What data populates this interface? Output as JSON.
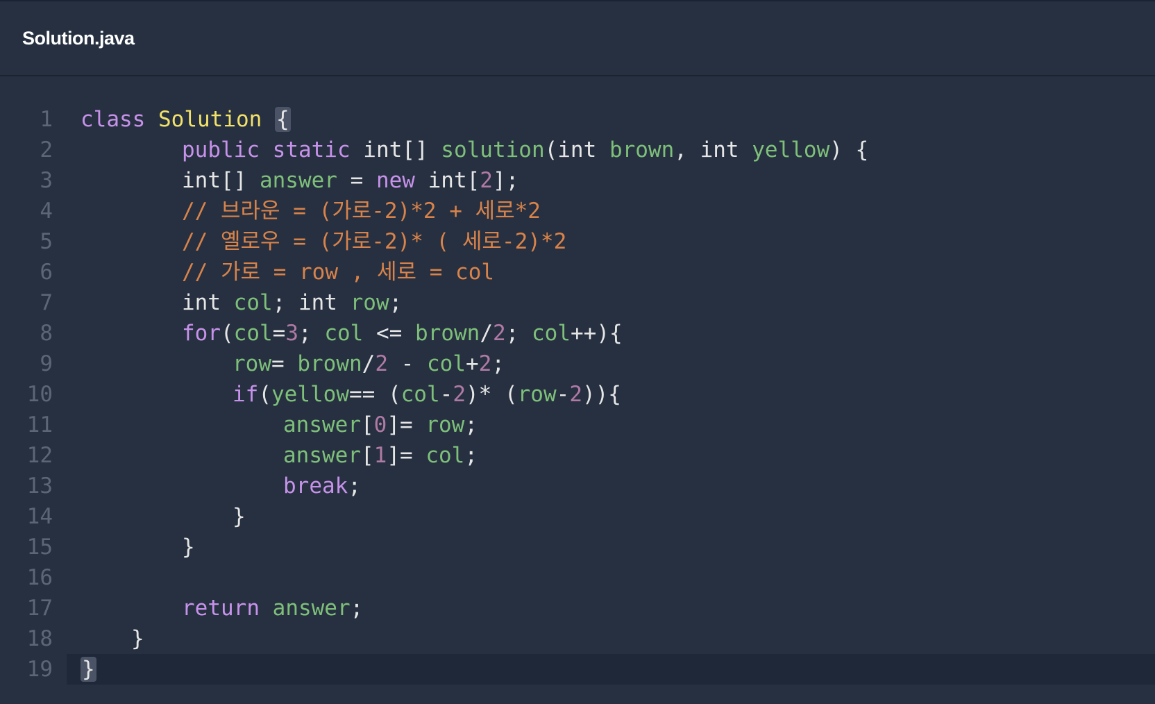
{
  "tab": {
    "file_name": "Solution.java"
  },
  "colors": {
    "background": "#263040",
    "keyword": "#c792ea",
    "class_name": "#f3e26a",
    "identifier": "#7ec07a",
    "number": "#b07aa6",
    "comment": "#d9834a",
    "text": "#e6e6e6",
    "line_number": "#5c6677"
  },
  "editor": {
    "active_line": 19,
    "lines": [
      {
        "number": "1",
        "indent": 0,
        "tokens": [
          [
            "kw",
            "class"
          ],
          [
            "tx",
            " "
          ],
          [
            "cls",
            "Solution"
          ],
          [
            "tx",
            " "
          ],
          [
            "hl",
            "{"
          ]
        ]
      },
      {
        "number": "2",
        "indent": 4,
        "tokens": [
          [
            "kw",
            "public"
          ],
          [
            "tx",
            " "
          ],
          [
            "kw",
            "static"
          ],
          [
            "tx",
            " int[] "
          ],
          [
            "id",
            "solution"
          ],
          [
            "tx",
            "(int "
          ],
          [
            "id",
            "brown"
          ],
          [
            "tx",
            ", int "
          ],
          [
            "id",
            "yellow"
          ],
          [
            "tx",
            ") {"
          ]
        ]
      },
      {
        "number": "3",
        "indent": 4,
        "tokens": [
          [
            "tx",
            "int[] "
          ],
          [
            "id",
            "answer"
          ],
          [
            "tx",
            " = "
          ],
          [
            "kw",
            "new"
          ],
          [
            "tx",
            " int["
          ],
          [
            "num",
            "2"
          ],
          [
            "tx",
            "];"
          ]
        ]
      },
      {
        "number": "4",
        "indent": 4,
        "tokens": [
          [
            "cm",
            "// 브라운 = (가로-2)*2 + 세로*2"
          ]
        ]
      },
      {
        "number": "5",
        "indent": 4,
        "tokens": [
          [
            "cm",
            "// 옐로우 = (가로-2)* ( 세로-2)*2"
          ]
        ]
      },
      {
        "number": "6",
        "indent": 4,
        "tokens": [
          [
            "cm",
            "// 가로 = row , 세로 = col"
          ]
        ]
      },
      {
        "number": "7",
        "indent": 4,
        "tokens": [
          [
            "tx",
            "int "
          ],
          [
            "id",
            "col"
          ],
          [
            "tx",
            "; int "
          ],
          [
            "id",
            "row"
          ],
          [
            "tx",
            ";"
          ]
        ]
      },
      {
        "number": "8",
        "indent": 4,
        "tokens": [
          [
            "kw",
            "for"
          ],
          [
            "tx",
            "("
          ],
          [
            "id",
            "col"
          ],
          [
            "tx",
            "="
          ],
          [
            "num",
            "3"
          ],
          [
            "tx",
            "; "
          ],
          [
            "id",
            "col"
          ],
          [
            "tx",
            " <= "
          ],
          [
            "id",
            "brown"
          ],
          [
            "tx",
            "/"
          ],
          [
            "num",
            "2"
          ],
          [
            "tx",
            "; "
          ],
          [
            "id",
            "col"
          ],
          [
            "tx",
            "++){"
          ]
        ]
      },
      {
        "number": "9",
        "indent": 6,
        "tokens": [
          [
            "id",
            "row"
          ],
          [
            "tx",
            "= "
          ],
          [
            "id",
            "brown"
          ],
          [
            "tx",
            "/"
          ],
          [
            "num",
            "2"
          ],
          [
            "tx",
            " - "
          ],
          [
            "id",
            "col"
          ],
          [
            "tx",
            "+"
          ],
          [
            "num",
            "2"
          ],
          [
            "tx",
            ";"
          ]
        ]
      },
      {
        "number": "10",
        "indent": 6,
        "tokens": [
          [
            "kw",
            "if"
          ],
          [
            "tx",
            "("
          ],
          [
            "id",
            "yellow"
          ],
          [
            "tx",
            "== ("
          ],
          [
            "id",
            "col"
          ],
          [
            "tx",
            "-"
          ],
          [
            "num",
            "2"
          ],
          [
            "tx",
            ")* ("
          ],
          [
            "id",
            "row"
          ],
          [
            "tx",
            "-"
          ],
          [
            "num",
            "2"
          ],
          [
            "tx",
            ")){"
          ]
        ]
      },
      {
        "number": "11",
        "indent": 8,
        "tokens": [
          [
            "id",
            "answer"
          ],
          [
            "tx",
            "["
          ],
          [
            "num",
            "0"
          ],
          [
            "tx",
            "]= "
          ],
          [
            "id",
            "row"
          ],
          [
            "tx",
            ";"
          ]
        ]
      },
      {
        "number": "12",
        "indent": 8,
        "tokens": [
          [
            "id",
            "answer"
          ],
          [
            "tx",
            "["
          ],
          [
            "num",
            "1"
          ],
          [
            "tx",
            "]= "
          ],
          [
            "id",
            "col"
          ],
          [
            "tx",
            ";"
          ]
        ]
      },
      {
        "number": "13",
        "indent": 8,
        "tokens": [
          [
            "kw",
            "break"
          ],
          [
            "tx",
            ";"
          ]
        ]
      },
      {
        "number": "14",
        "indent": 6,
        "tokens": [
          [
            "tx",
            "}"
          ]
        ]
      },
      {
        "number": "15",
        "indent": 4,
        "tokens": [
          [
            "tx",
            "}"
          ]
        ]
      },
      {
        "number": "16",
        "indent": 0,
        "tokens": []
      },
      {
        "number": "17",
        "indent": 4,
        "tokens": [
          [
            "kw",
            "return"
          ],
          [
            "tx",
            " "
          ],
          [
            "id",
            "answer"
          ],
          [
            "tx",
            ";"
          ]
        ]
      },
      {
        "number": "18",
        "indent": 2,
        "tokens": [
          [
            "tx",
            "}"
          ]
        ]
      },
      {
        "number": "19",
        "indent": 0,
        "tokens": [
          [
            "hl",
            "}"
          ]
        ]
      }
    ]
  }
}
